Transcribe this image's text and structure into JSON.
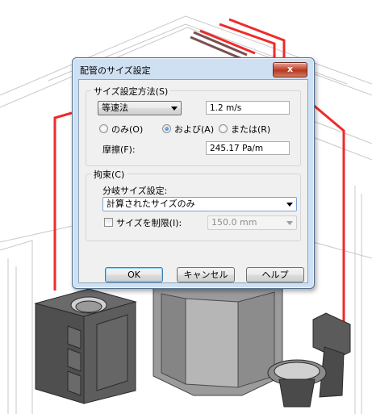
{
  "dialog": {
    "title": "配管のサイズ設定",
    "close_symbol": "x",
    "sizing_method": {
      "label": "サイズ設定方法(S)",
      "method_value": "等速法",
      "velocity_value": "1.2 m/s",
      "radio_only": "のみ(O)",
      "radio_and": "および(A)",
      "radio_or": "または(R)",
      "selected": "and",
      "friction_label": "摩擦(F):",
      "friction_value": "245.17 Pa/m"
    },
    "constraints": {
      "label": "拘束(C)",
      "branch_label": "分岐サイズ設定:",
      "branch_value": "計算されたサイズのみ",
      "restrict_label": "サイズを制限(I):",
      "restrict_checked": false,
      "restrict_value": "150.0 mm"
    },
    "buttons": {
      "ok": "OK",
      "cancel": "キャンセル",
      "help": "ヘルプ"
    }
  },
  "colors": {
    "pipe": "#ee2b2b",
    "dialog_frame": "#cfe0f3",
    "close_button": "#c24a34"
  }
}
